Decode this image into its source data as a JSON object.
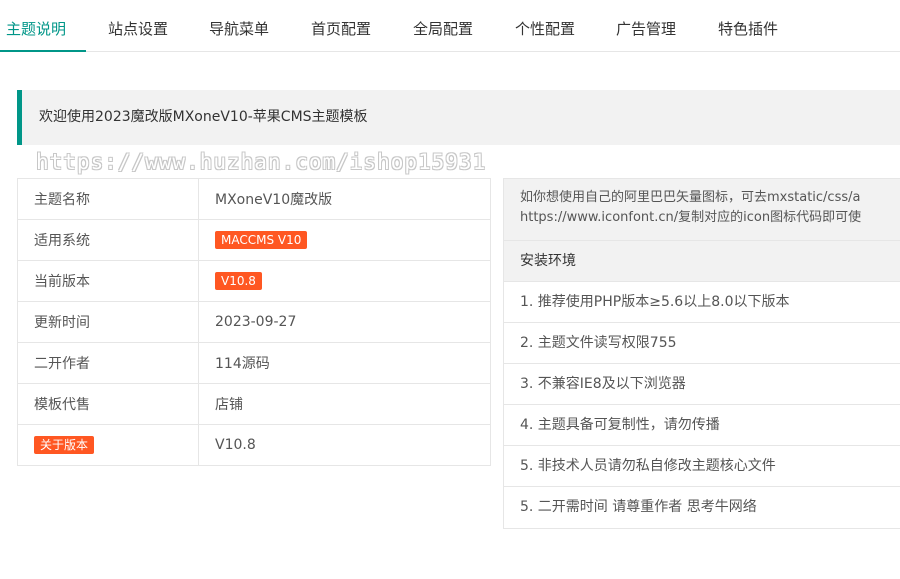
{
  "tabs": [
    {
      "label": "主题说明"
    },
    {
      "label": "站点设置"
    },
    {
      "label": "导航菜单"
    },
    {
      "label": "首页配置"
    },
    {
      "label": "全局配置"
    },
    {
      "label": "个性配置"
    },
    {
      "label": "广告管理"
    },
    {
      "label": "特色插件"
    }
  ],
  "active_tab": "主题说明",
  "welcome_text": "欢迎使用2023魔改版MXoneV10-苹果CMS主题模板",
  "watermark": "https://www.huzhan.com/ishop15931",
  "info_rows": [
    {
      "label": "主题名称",
      "value": "MXoneV10魔改版"
    },
    {
      "label": "适用系统",
      "value": "MACCMS V10"
    },
    {
      "label": "当前版本",
      "value": "V10.8"
    },
    {
      "label": "更新时间",
      "value": "2023-09-27"
    },
    {
      "label": "二开作者",
      "value": "114源码"
    },
    {
      "label": "模板代售",
      "value": "店铺"
    },
    {
      "label": "关于版本",
      "value": "V10.8"
    }
  ],
  "notice": {
    "line1": "如你想使用自己的阿里巴巴矢量图标，可去mxstatic/css/a",
    "line2": "https://www.iconfont.cn/复制对应的icon图标代码即可使"
  },
  "env": {
    "title": "安装环境",
    "items": [
      "1. 推荐使用PHP版本≥5.6以上8.0以下版本",
      "2. 主题文件读写权限755",
      "3. 不兼容IE8及以下浏览器",
      "4. 主题具备可复制性，请勿传播",
      "5. 非技术人员请勿私自修改主题核心文件",
      "5. 二开需时间 请尊重作者 思考牛网络"
    ]
  },
  "colors": {
    "accent": "#009688",
    "badge": "#ff5722",
    "panel_bg": "#f2f2f2",
    "border": "#e6e6e6"
  }
}
